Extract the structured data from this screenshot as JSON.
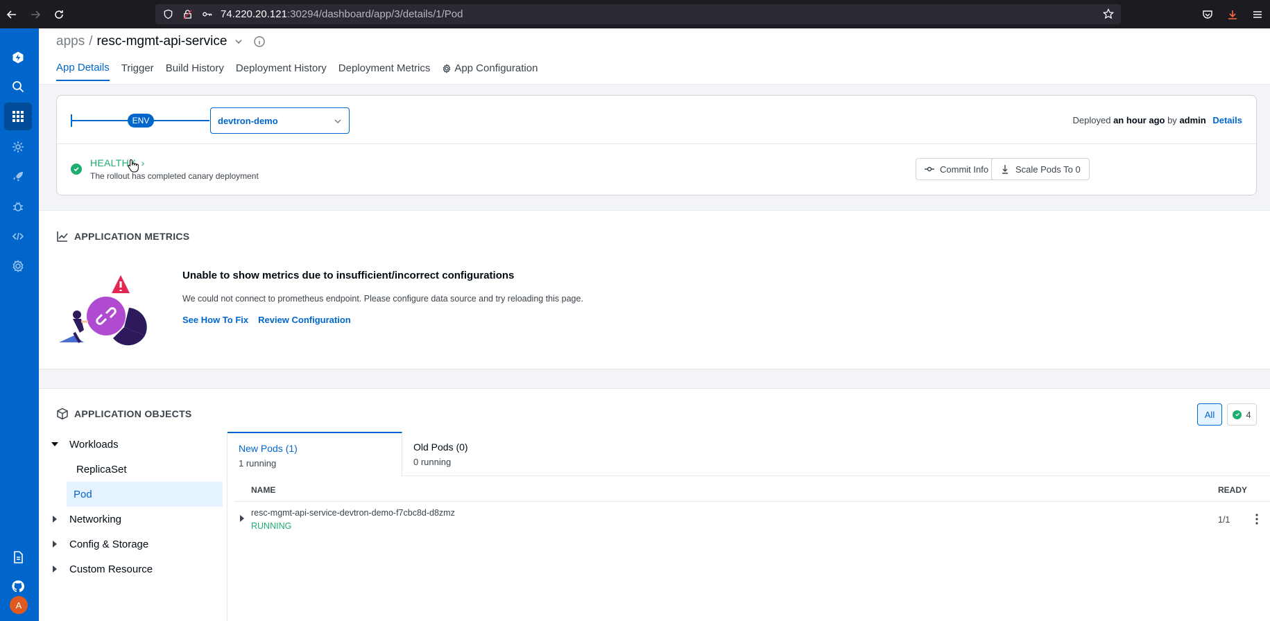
{
  "browser": {
    "url_host": "74.220.20.121",
    "url_path": ":30294/dashboard/app/3/details/1/Pod"
  },
  "header": {
    "breadcrumb_root": "apps",
    "separator": "/",
    "app_name": "resc-mgmt-api-service",
    "tabs": [
      {
        "label": "App Details"
      },
      {
        "label": "Trigger"
      },
      {
        "label": "Build History"
      },
      {
        "label": "Deployment History"
      },
      {
        "label": "Deployment Metrics"
      },
      {
        "label": "App Configuration"
      }
    ]
  },
  "env": {
    "badge": "ENV",
    "selected": "devtron-demo",
    "deployed_prefix": "Deployed",
    "deployed_time": "an hour ago",
    "deployed_by_word": "by",
    "deployed_by": "admin",
    "details_link": "Details"
  },
  "health": {
    "status": "HEALTHY",
    "chevron": "›",
    "message": "The rollout has completed canary deployment",
    "commit_info": "Commit Info",
    "scale_pods": "Scale Pods To 0"
  },
  "metrics": {
    "title": "APPLICATION METRICS",
    "heading": "Unable to show metrics due to insufficient/incorrect configurations",
    "description": "We could not connect to prometheus endpoint. Please configure data source and try reloading this page.",
    "link_fix": "See How To Fix",
    "link_review": "Review Configuration"
  },
  "objects": {
    "title": "APPLICATION OBJECTS",
    "filter_all": "All",
    "filter_healthy_count": "4",
    "tree": {
      "workloads": "Workloads",
      "replicaset": "ReplicaSet",
      "pod": "Pod",
      "networking": "Networking",
      "config_storage": "Config & Storage",
      "custom_resource": "Custom Resource"
    },
    "pods": {
      "new_tab": "New Pods (1)",
      "new_sub": "1 running",
      "old_tab": "Old Pods (0)",
      "old_sub": "0 running",
      "col_name": "NAME",
      "col_ready": "READY",
      "rows": [
        {
          "name": "resc-mgmt-api-service-devtron-demo-f7cbc8d-d8zmz",
          "status": "RUNNING",
          "ready": "1/1"
        }
      ]
    }
  },
  "user": {
    "avatar_letter": "A"
  },
  "colors": {
    "primary": "#0066cc",
    "healthy": "#1dad70",
    "nav": "#0066cc"
  }
}
